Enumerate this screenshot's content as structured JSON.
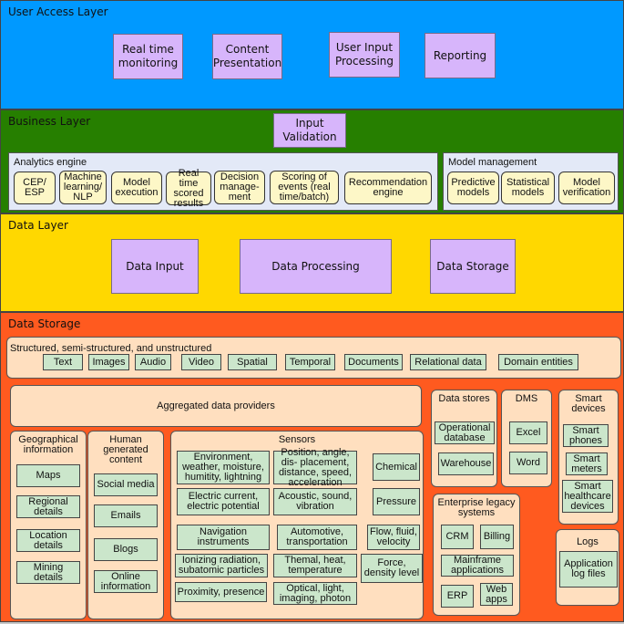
{
  "layers": {
    "user_access": {
      "title": "User Access Layer",
      "color": "#0099ff",
      "items": [
        "Real time monitoring",
        "Content Presentation",
        "User Input Processing",
        "Reporting"
      ]
    },
    "business": {
      "title": "Business Layer",
      "color": "#267f00",
      "input_validation": "Input Validation",
      "analytics_engine": {
        "title": "Analytics engine",
        "items": [
          "CEP/ ESP",
          "Machine learning/ NLP",
          "Model execution",
          "Real time scored results",
          "Decision manage- ment",
          "Scoring of events (real time/batch)",
          "Recommendation engine"
        ]
      },
      "model_management": {
        "title": "Model management",
        "items": [
          "Predictive models",
          "Statistical models",
          "Model verification"
        ]
      }
    },
    "data": {
      "title": "Data Layer",
      "color": "#ffd800",
      "items": [
        "Data Input",
        "Data Processing",
        "Data Storage"
      ]
    },
    "storage": {
      "title": "Data Storage",
      "color": "#ff5a1f",
      "structured": {
        "title": "Structured, semi-structured, and unstructured",
        "items": [
          "Text",
          "Images",
          "Audio",
          "Video",
          "Spatial",
          "Temporal",
          "Documents",
          "Relational data",
          "Domain entities"
        ]
      },
      "aggregated": "Aggregated data providers",
      "geographical": {
        "title": "Geographical information",
        "items": [
          "Maps",
          "Regional details",
          "Location details",
          "Mining details"
        ]
      },
      "human": {
        "title": "Human generated content",
        "items": [
          "Social media",
          "Emails",
          "Blogs",
          "Online information"
        ]
      },
      "sensors": {
        "title": "Sensors",
        "items": [
          "Environment, weather, moisture, humitity, lightning",
          "Position, angle, dis- placement, distance, speed, acceleration",
          "Chemical",
          "Electric current, electric potential",
          "Acoustic, sound, vibration",
          "Pressure",
          "Navigation instruments",
          "Automotive, transportation",
          "Flow, fluid, velocity",
          "Ionizing radiation, subatomic particles",
          "Themal, heat, temperature",
          "Force, density level",
          "Proximity, presence",
          "Optical, light, imaging, photon"
        ]
      },
      "data_stores": {
        "title": "Data stores",
        "items": [
          "Operational database",
          "Warehouse"
        ]
      },
      "dms": {
        "title": "DMS",
        "items": [
          "Excel",
          "Word"
        ]
      },
      "smart_devices": {
        "title": "Smart devices",
        "items": [
          "Smart phones",
          "Smart meters",
          "Smart healthcare devices"
        ]
      },
      "enterprise": {
        "title": "Enterprise legacy systems",
        "items": [
          "CRM",
          "Billing",
          "Mainframe applications",
          "ERP",
          "Web apps"
        ]
      },
      "logs": {
        "title": "Logs",
        "items": [
          "Application log files"
        ]
      }
    }
  }
}
